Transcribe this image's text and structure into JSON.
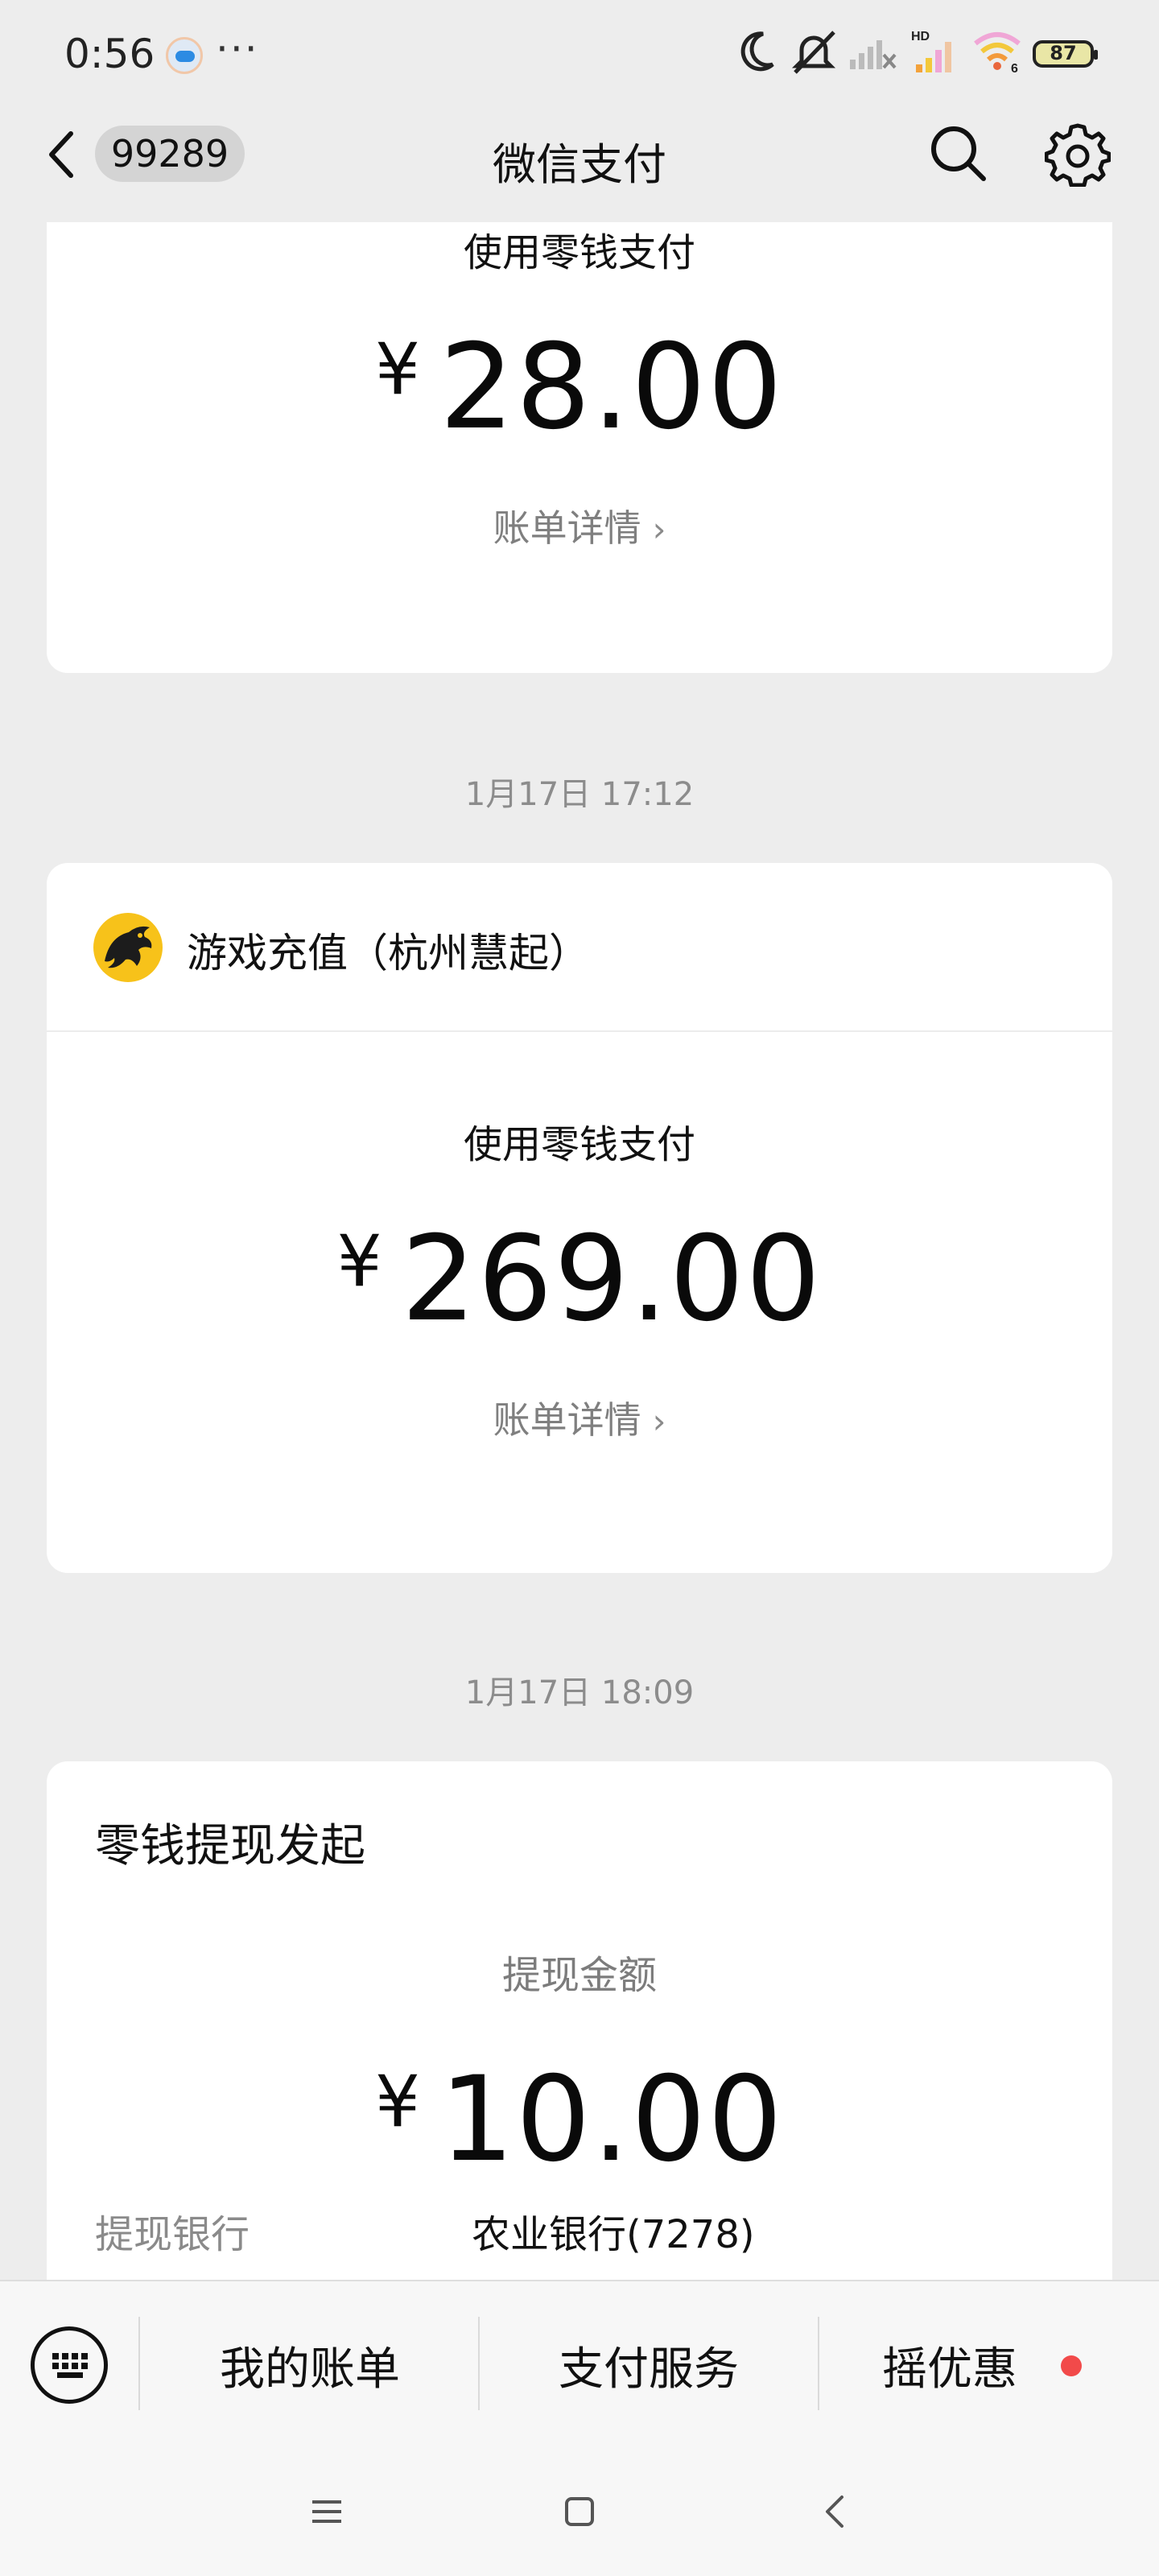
{
  "status_bar": {
    "time": "0:56",
    "more": "···",
    "battery": "87",
    "signal_label": "HD",
    "wifi_label": "6"
  },
  "nav": {
    "unread_count": "99289",
    "title": "微信支付"
  },
  "transactions": [
    {
      "pay_method": "使用零钱支付",
      "currency": "¥",
      "amount": "28.00",
      "detail_link": "账单详情"
    },
    {
      "timestamp": "1月17日 17:12",
      "merchant": "游戏充值（杭州慧起）",
      "pay_method": "使用零钱支付",
      "currency": "¥",
      "amount": "269.00",
      "detail_link": "账单详情"
    },
    {
      "timestamp": "1月17日 18:09",
      "title": "零钱提现发起",
      "amount_label": "提现金额",
      "currency": "¥",
      "amount": "10.00",
      "bank_label": "提现银行",
      "bank_value": "农业银行(7278)"
    }
  ],
  "bottom_menu": {
    "items": [
      "我的账单",
      "支付服务",
      "摇优惠"
    ],
    "promo_dot_color": "#f24a4a"
  },
  "icons": {
    "back": "chevron-left-icon",
    "search": "search-icon",
    "settings": "gear-icon",
    "keyboard": "keyboard-icon",
    "merchant_logo": "dragon-logo-icon"
  },
  "colors": {
    "background": "#ededed",
    "card": "#ffffff",
    "secondary_text": "#7f7f7f"
  }
}
